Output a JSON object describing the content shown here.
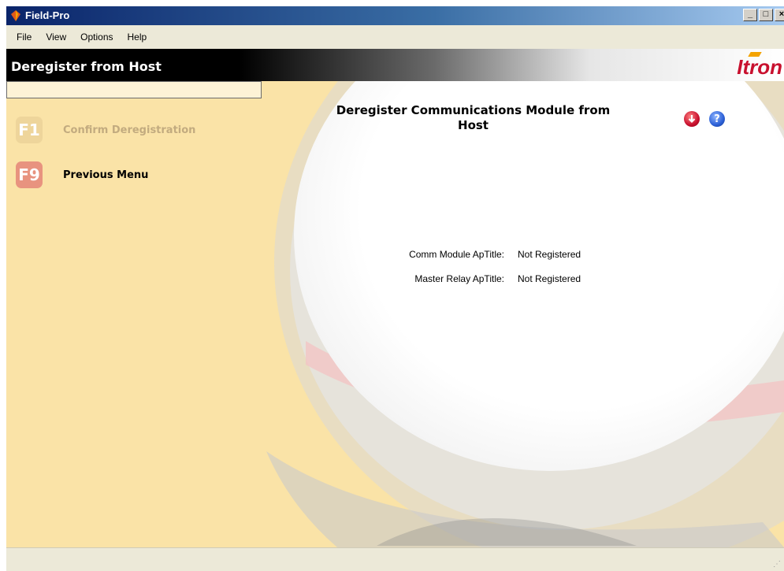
{
  "window": {
    "title": "Field-Pro",
    "controls": {
      "minimize": "_",
      "maximize": "□",
      "close": "×"
    }
  },
  "menu": [
    "File",
    "View",
    "Options",
    "Help"
  ],
  "header": {
    "title": "Deregister from Host",
    "logo_text": "Itron"
  },
  "sidebar": {
    "items": [
      {
        "key": "F1",
        "label": "Confirm Deregistration",
        "enabled": false
      },
      {
        "key": "F9",
        "label": "Previous Menu",
        "enabled": true
      }
    ]
  },
  "main": {
    "heading_line1": "Deregister Communications Module from",
    "heading_line2": "Host",
    "icons": [
      "download-icon",
      "help-icon"
    ],
    "fields": [
      {
        "label": "Comm Module ApTitle:",
        "value": "Not Registered"
      },
      {
        "label": "Master Relay ApTitle:",
        "value": "Not Registered"
      }
    ]
  },
  "colors": {
    "background": "#fae3a7",
    "brand_red": "#c8102e",
    "fkey_disabled": "#eed59b",
    "fkey_active": "#e8937f"
  }
}
